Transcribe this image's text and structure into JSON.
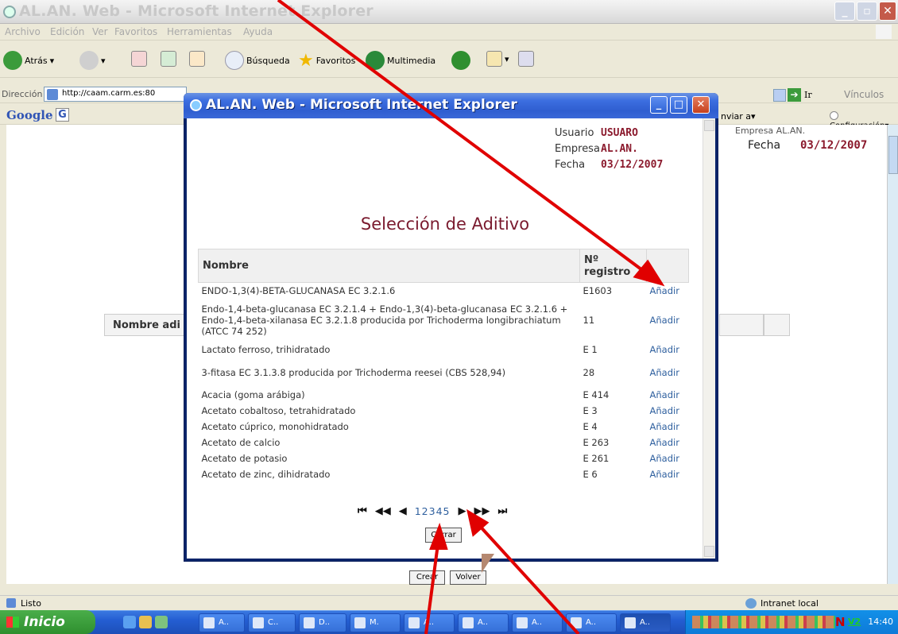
{
  "browser": {
    "title": "AL.AN. Web - Microsoft Internet Explorer",
    "menu": [
      "Archivo",
      "Edición",
      "Ver",
      "Favoritos",
      "Herramientas",
      "Ayuda"
    ],
    "toolbar": {
      "back": "Atrás",
      "search": "Búsqueda",
      "favorites": "Favoritos",
      "multimedia": "Multimedia"
    },
    "address_label": "Dirección",
    "address_value": "http://caam.carm.es:80",
    "go_label": "Ir",
    "links_label": "Vínculos",
    "google_label": "Google",
    "google_button": "G",
    "send_label": "nviar a",
    "config_label": "Configuración",
    "status_text": "Listo",
    "zone_text": "Intranet local"
  },
  "background_page": {
    "usuario_partial": "Empresa AL.AN.",
    "fecha_label": "Fecha",
    "fecha_value": "03/12/2007",
    "nombre_label": "Nombre adi",
    "crear_label": "Crear",
    "volver_label": "Volver"
  },
  "popup": {
    "title": "AL.AN. Web - Microsoft Internet Explorer",
    "user_info": {
      "usuario_label": "Usuario",
      "usuario_value": "USUARO",
      "empresa_label": "Empresa",
      "empresa_value": "AL.AN.",
      "fecha_label": "Fecha",
      "fecha_value": "03/12/2007"
    },
    "heading": "Selección de Aditivo",
    "table": {
      "col_name": "Nombre",
      "col_reg_1": "Nº",
      "col_reg_2": "registro",
      "rows": [
        {
          "name": "ENDO-1,3(4)-BETA-GLUCANASA EC 3.2.1.6",
          "reg": "E1603",
          "action": "Añadir"
        },
        {
          "name": "Endo-1,4-beta-glucanasa EC 3.2.1.4 + Endo-1,3(4)-beta-glucanasa EC 3.2.1.6 + Endo-1,4-beta-xilanasa EC 3.2.1.8 producida por Trichoderma longibrachiatum (ATCC 74 252)",
          "reg": "11",
          "action": "Añadir"
        },
        {
          "name": "Lactato ferroso, trihidratado",
          "reg": "E 1",
          "action": "Añadir"
        },
        {
          "name": "3-fitasa EC 3.1.3.8 producida por Trichoderma reesei (CBS 528,94)",
          "reg": "28",
          "action": "Añadir"
        },
        {
          "name": "Acacia (goma arábiga)",
          "reg": "E 414",
          "action": "Añadir"
        },
        {
          "name": "Acetato cobaltoso, tetrahidratado",
          "reg": "E 3",
          "action": "Añadir"
        },
        {
          "name": "Acetato cúprico, monohidratado",
          "reg": "E 4",
          "action": "Añadir"
        },
        {
          "name": "Acetato de calcio",
          "reg": "E 263",
          "action": "Añadir"
        },
        {
          "name": "Acetato de potasio",
          "reg": "E 261",
          "action": "Añadir"
        },
        {
          "name": "Acetato de zinc, dihidratado",
          "reg": "E 6",
          "action": "Añadir"
        }
      ]
    },
    "pager": {
      "first": "⏮",
      "prev_block": "◀◀",
      "prev": "◀",
      "pages": [
        "1",
        "2",
        "3",
        "4",
        "5"
      ],
      "next": "▶",
      "next_block": "▶▶",
      "last": "⏭"
    },
    "cerrar_label": "Cerrar"
  },
  "taskbar": {
    "start_label": "Inicio",
    "tasks": [
      "A..",
      "C..",
      "D..",
      "M.",
      "A..",
      "A..",
      "A..",
      "A..",
      "A.."
    ],
    "tray_letter": "N",
    "tray_badge": "V2",
    "clock": "14:40"
  },
  "accent_colors": {
    "heading": "#7a1a2e",
    "link": "#2e5f9e",
    "arrow": "#e00000"
  }
}
